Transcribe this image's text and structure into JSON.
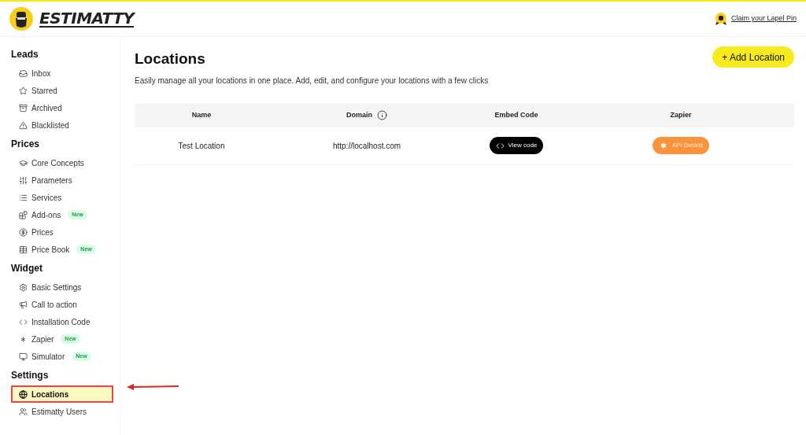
{
  "header": {
    "logo_text": "ESTIMATTY",
    "claim_link": "Claim your Lapel Pin"
  },
  "sidebar": {
    "sections": [
      {
        "title": "Leads",
        "items": [
          {
            "label": "Inbox",
            "selected": false
          },
          {
            "label": "Starred",
            "selected": false
          },
          {
            "label": "Archived",
            "selected": false
          },
          {
            "label": "Blacklisted",
            "selected": false
          }
        ]
      },
      {
        "title": "Prices",
        "items": [
          {
            "label": "Core Concepts",
            "selected": false
          },
          {
            "label": "Parameters",
            "selected": false
          },
          {
            "label": "Services",
            "selected": false
          },
          {
            "label": "Add-ons",
            "badge": "New",
            "selected": false
          },
          {
            "label": "Prices",
            "selected": false
          },
          {
            "label": "Price Book",
            "badge": "New",
            "selected": false
          }
        ]
      },
      {
        "title": "Widget",
        "items": [
          {
            "label": "Basic Settings",
            "selected": false
          },
          {
            "label": "Call to action",
            "selected": false
          },
          {
            "label": "Installation Code",
            "selected": false
          },
          {
            "label": "Zapier",
            "badge": "New",
            "selected": false
          },
          {
            "label": "Simulator",
            "badge": "New",
            "selected": false
          }
        ]
      },
      {
        "title": "Settings",
        "items": [
          {
            "label": "Locations",
            "selected": true
          },
          {
            "label": "Estimatty Users",
            "selected": false
          }
        ]
      }
    ]
  },
  "main": {
    "title": "Locations",
    "subtitle": "Easily manage all your locations in one place. Add, edit, and configure your locations with a few clicks",
    "add_button": "+ Add Location",
    "table": {
      "columns": [
        "Name",
        "Domain",
        "Embed Code",
        "Zapier"
      ],
      "rows": [
        {
          "name": "Test Location",
          "domain": "http://localhost.com",
          "embed_button": "View code",
          "zapier_button": "API Details"
        }
      ]
    }
  }
}
